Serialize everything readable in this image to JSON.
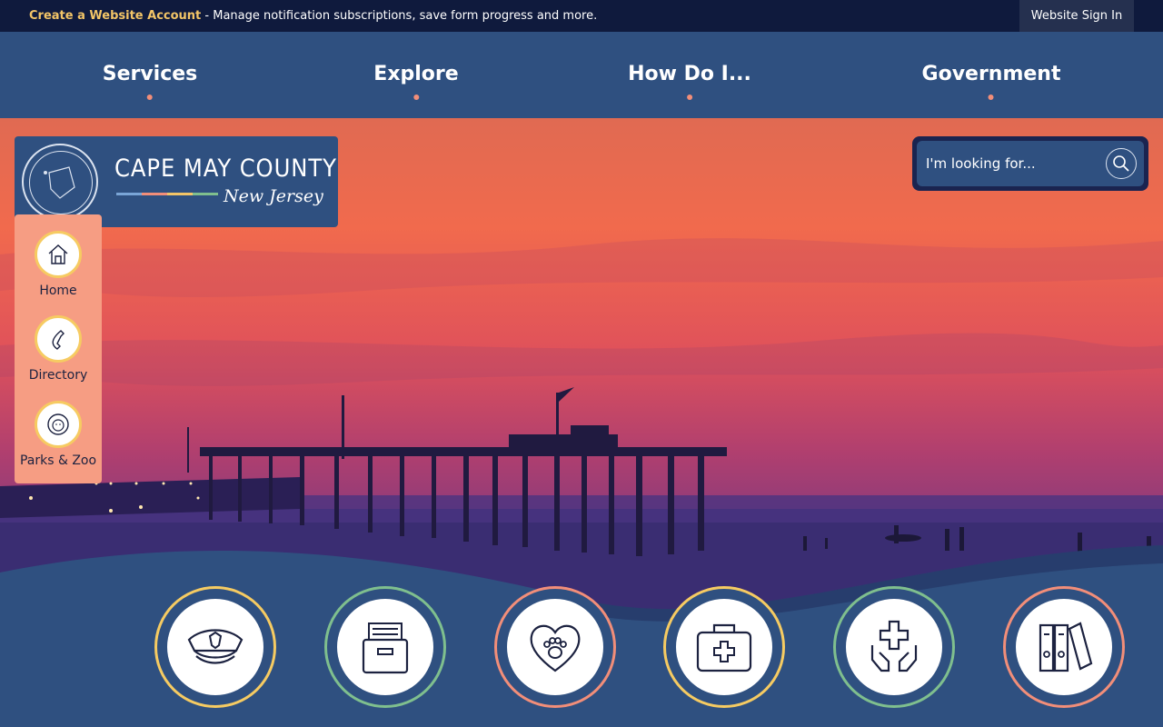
{
  "topbar": {
    "create_account_link": "Create a Website Account",
    "create_account_text": " - Manage notification subscriptions, save form progress and more.",
    "sign_in": "Website Sign In"
  },
  "nav": {
    "items": [
      {
        "label": "Services"
      },
      {
        "label": "Explore"
      },
      {
        "label": "How Do I..."
      },
      {
        "label": "Government"
      }
    ]
  },
  "logo": {
    "title": "CAPE MAY COUNTY",
    "subtitle": "New Jersey",
    "seal_text": "CAPE MAY COUNTY",
    "stripe_colors": [
      "#7aa5d6",
      "#f28e79",
      "#f3c567",
      "#7fbf8e"
    ]
  },
  "quick_links": [
    {
      "label": "Home",
      "icon": "home-icon"
    },
    {
      "label": "Directory",
      "icon": "phone-icon"
    },
    {
      "label": "Parks & Zoo",
      "icon": "lion-icon"
    }
  ],
  "search": {
    "placeholder": "I'm looking for..."
  },
  "services": [
    {
      "icon": "police-hat-icon",
      "ring": "#f6cb62"
    },
    {
      "icon": "archive-box-icon",
      "ring": "#7fbf8e"
    },
    {
      "icon": "pet-heart-icon",
      "ring": "#f28e79"
    },
    {
      "icon": "medical-kit-icon",
      "ring": "#f6cb62"
    },
    {
      "icon": "care-hands-icon",
      "ring": "#7fbf8e"
    },
    {
      "icon": "binders-icon",
      "ring": "#f28e79"
    }
  ],
  "colors": {
    "topbar": "#0f1a3d",
    "nav": "#2f5080",
    "accent_gold": "#f3c567",
    "accent_coral": "#f28e79",
    "accent_green": "#7fbf8e"
  }
}
